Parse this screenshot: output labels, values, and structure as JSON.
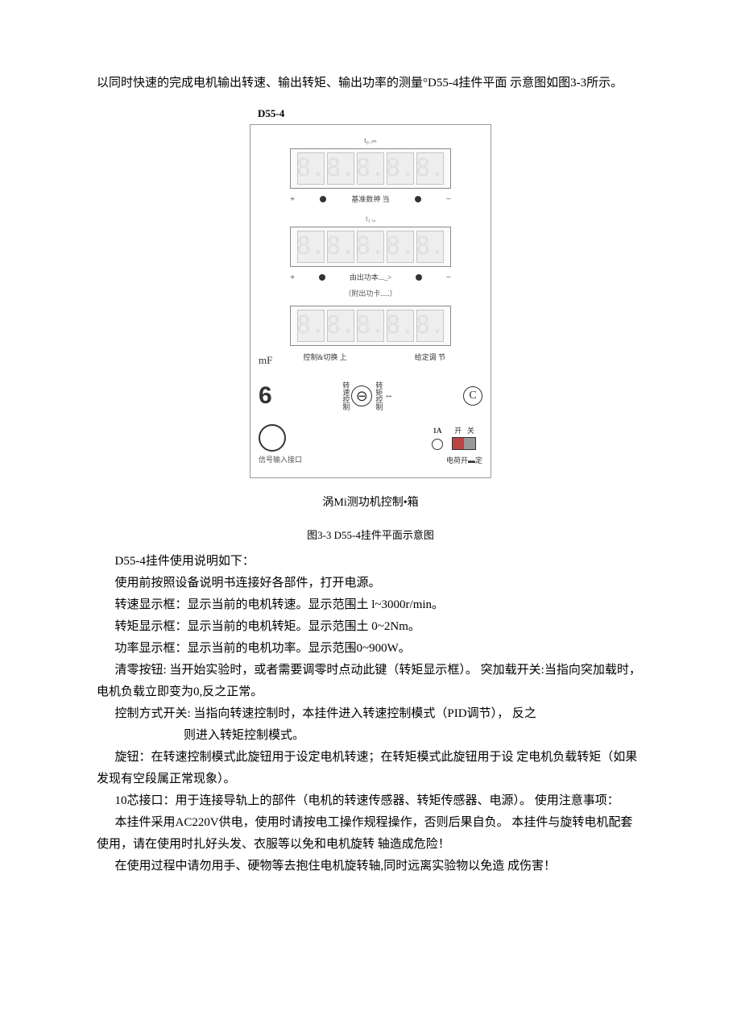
{
  "intro": "以同时快速的完成电机输出转速、输出转矩、输出功率的测量°D55-4挂件平面 示意图如图3-3所示。",
  "panel": {
    "model": "D55-4",
    "disp1_unit": "t₀ ᵣₘ",
    "pm_text1": "基准数神 当",
    "disp2_unit": "t₁ ᵢₐ",
    "pm_text2": "由出功本..._>",
    "sub_label": "（附出功卡.....）",
    "mf": "mF",
    "ctrl_label": "控制&切换 上",
    "adj_label": "给定调 节",
    "big_six": "6",
    "mode_left": "转速控制",
    "mode_right": "转矩控制",
    "current": "1A",
    "sw_on": "开",
    "sw_off": "关",
    "sw_caption": "电荷开▬定",
    "port": "信号输入接口",
    "caption": "涡Mi测功机控制•箱"
  },
  "fig_no": "图3-3 D55-4挂件平面示意图",
  "lines": {
    "l1": "D55-4挂件使用说明如下：",
    "l2": "使用前按照设备说明书连接好各部件，打开电源。",
    "l3": "转速显示框：显示当前的电机转速。显示范围土 l~3000r/min。",
    "l4": "转矩显示框：显示当前的电机转矩。显示范围土 0~2Nm。",
    "l5": "功率显示框：显示当前的电机功率。显示范围0~900W。",
    "l6": "清零按钮: 当开始实验时，或者需要调零时点动此键（转矩显示框）。 突加载开关:当指向突加载时，电机负载立即变为0,反之正常。",
    "l7": "控制方式开关: 当指向转速控制时，本挂件进入转速控制模式（PID调节），   反之",
    "l7b": "则进入转矩控制模式。",
    "l8": "旋钮：在转速控制模式此旋钮用于设定电机转速；在转矩模式此旋钮用于设 定电机负载转矩（如果发现有空段属正常现象）。",
    "l9": "10芯接口：用于连接导轨上的部件（电机的转速传感器、转矩传感器、电源）。 使用注意事项：",
    "l10": "本挂件采用AC220V供电，使用时请按电工操作规程操作，否则后果自负。 本挂件与旋转电机配套使用，请在使用时扎好头发、衣服等以免和电机旋转 轴造成危险！",
    "l11": "在使用过程中请勿用手、硬物等去抱住电机旋转轴,同时远离实验物以免造 成伤害！"
  }
}
